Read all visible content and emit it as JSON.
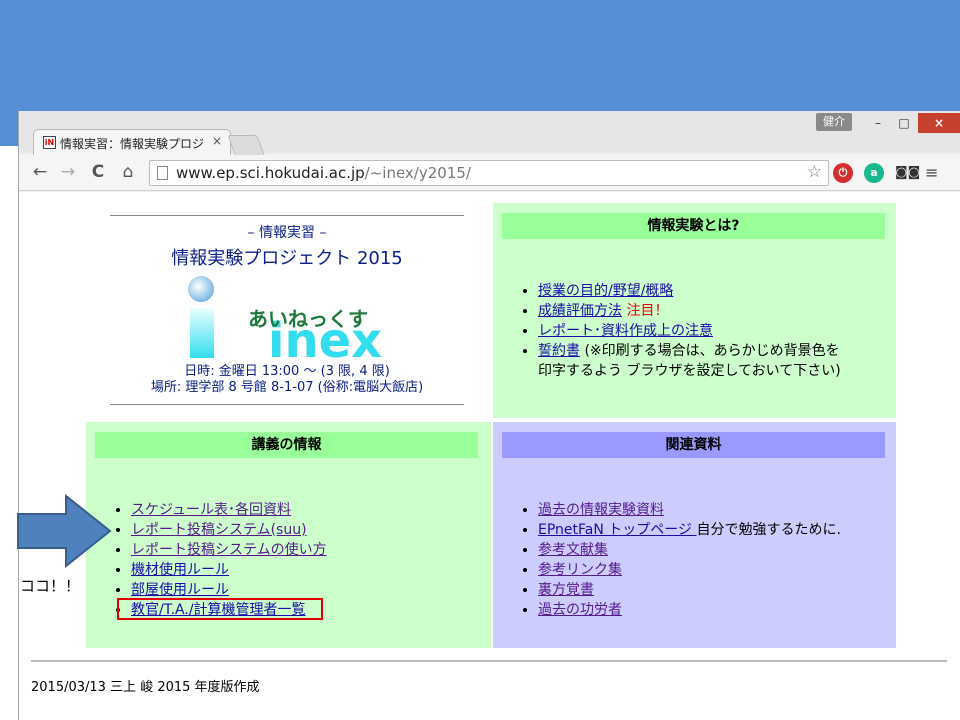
{
  "tab": {
    "favicon": "iN",
    "title": "情報実習：情報実験プロジ",
    "close": "×"
  },
  "window": {
    "user": "健介",
    "minimize": "–",
    "maximize": "□",
    "close": "×"
  },
  "toolbar": {
    "back": "←",
    "forward": "→",
    "reload": "C",
    "home": "⌂",
    "url_host": "www.ep.sci.hokudai.ac.jp",
    "url_path": "/~inex/y2015/",
    "star": "☆",
    "ext1": "⏻",
    "ext2": "a",
    "ext3": "◙◙",
    "menu": "≡"
  },
  "logo": {
    "subtitle": "– 情報実習 –",
    "title": "情報実験プロジェクト 2015",
    "kana": "あいねっくす",
    "brand": "inex",
    "datetime": "日時: 金曜日 13:00 〜 (3 限, 4 限)",
    "place": "場所: 理学部 8 号館 8-1-07 (俗称:電脳大飯店)"
  },
  "about": {
    "header": "情報実験とは?",
    "items": [
      {
        "link": "授業の目的/野望/概略",
        "note": ""
      },
      {
        "link": "成績評価方法",
        "note": "注目！"
      },
      {
        "link": "レポート･資料作成上の注意",
        "note": ""
      },
      {
        "link": "誓約書",
        "note": "(※印刷する場合は、あらかじめ背景色を"
      }
    ],
    "note_cont": "印字するよう ブラウザを設定しておいて下さい)"
  },
  "lecture": {
    "header": "講義の情報",
    "items": [
      "スケジュール表･各回資料",
      "レポート投稿システム(suu)",
      "レポート投稿システムの使い方",
      "機材使用ルール",
      "部屋使用ルール",
      "教官/T.A./計算機管理者一覧"
    ]
  },
  "related": {
    "header": "関連資料",
    "items": [
      {
        "link": "過去の情報実験資料",
        "note": ""
      },
      {
        "link": "EPnetFaN トップページ ",
        "note": "自分で勉強するために."
      },
      {
        "link": "参考文献集",
        "note": ""
      },
      {
        "link": "参考リンク集",
        "note": ""
      },
      {
        "link": "裏方覚書",
        "note": ""
      },
      {
        "link": "過去の功労者",
        "note": ""
      }
    ]
  },
  "footer": {
    "text": "2015/03/13 三上 峻 2015 年度版作成"
  },
  "annotation": {
    "label": "ココ！！"
  }
}
